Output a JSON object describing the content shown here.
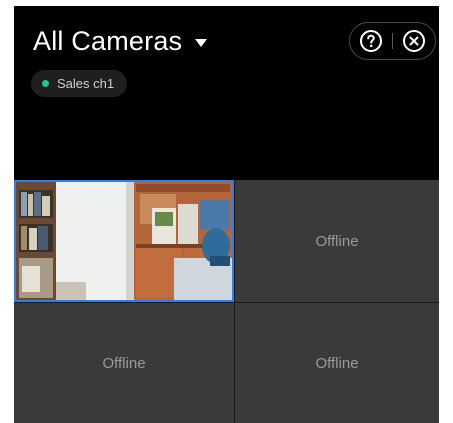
{
  "header": {
    "title": "All Cameras",
    "help_icon": "help-circle-icon",
    "close_icon": "close-circle-icon",
    "channel": {
      "label": "Sales ch1",
      "status_color": "#1fc78d"
    }
  },
  "grid": {
    "tiles": [
      {
        "label": "",
        "status": "live",
        "selected": true
      },
      {
        "label": "Offline",
        "status": "offline"
      },
      {
        "label": "Offline",
        "status": "offline"
      },
      {
        "label": "Offline",
        "status": "offline"
      }
    ]
  },
  "colors": {
    "background": "#000000",
    "tile_background": "#3a3a3a",
    "selection_border": "#2f7fe8",
    "status_online": "#1fc78d"
  }
}
